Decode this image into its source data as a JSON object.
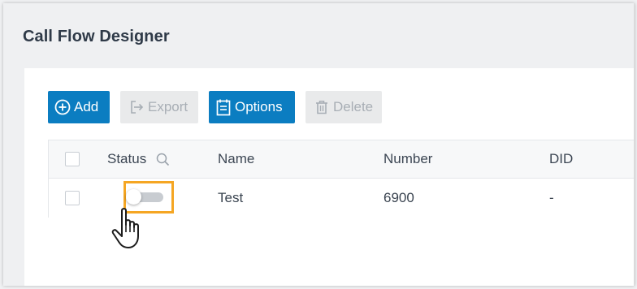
{
  "page": {
    "title": "Call Flow Designer"
  },
  "toolbar": {
    "add_label": "Add",
    "export_label": "Export",
    "options_label": "Options",
    "delete_label": "Delete"
  },
  "table": {
    "columns": {
      "status": "Status",
      "name": "Name",
      "number": "Number",
      "did": "DID"
    },
    "rows": [
      {
        "status": "off",
        "name": "Test",
        "number": "6900",
        "did": "-"
      }
    ]
  },
  "colors": {
    "primary": "#0b7dc1",
    "highlight": "#f5a623"
  },
  "icons": [
    "plus-circle-icon",
    "export-icon",
    "options-icon",
    "trash-icon",
    "search-icon",
    "hand-cursor-icon"
  ]
}
